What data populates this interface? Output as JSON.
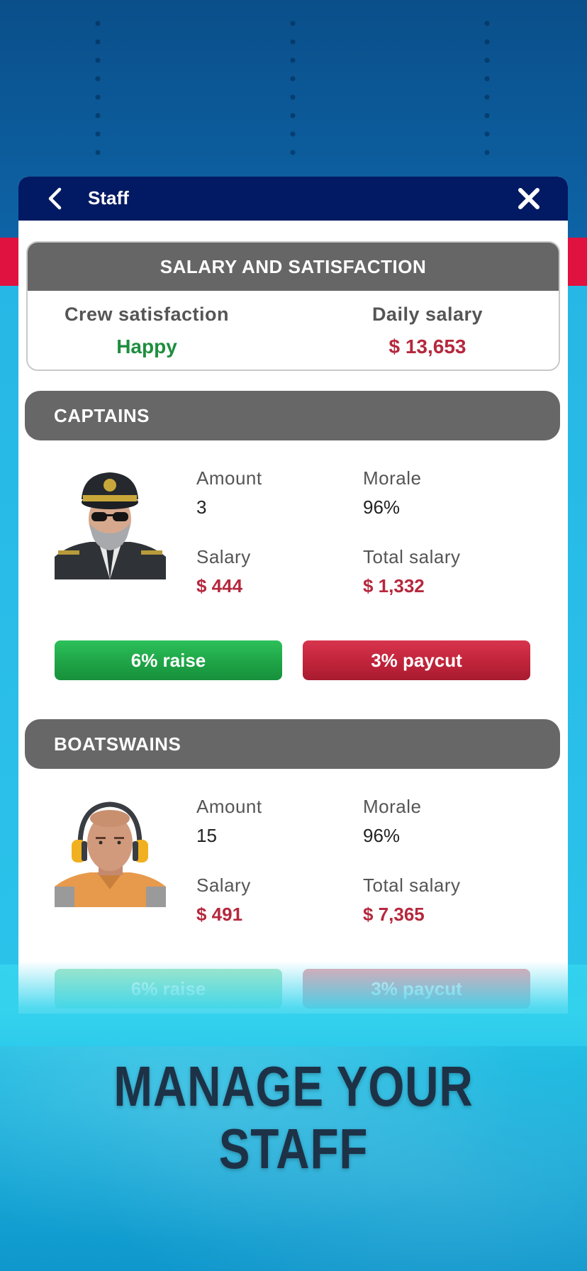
{
  "window": {
    "title": "Staff"
  },
  "icons": {
    "back": "chevron-left-icon",
    "close": "close-icon"
  },
  "summary": {
    "header": "SALARY AND SATISFACTION",
    "satisfaction_label": "Crew satisfaction",
    "satisfaction_value": "Happy",
    "daily_salary_label": "Daily salary",
    "daily_salary_value": "$ 13,653"
  },
  "sections": [
    {
      "header": "CAPTAINS",
      "amount_label": "Amount",
      "amount_value": "3",
      "morale_label": "Morale",
      "morale_value": "96%",
      "salary_label": "Salary",
      "salary_value": "$ 444",
      "total_salary_label": "Total salary",
      "total_salary_value": "$ 1,332",
      "raise_label": "6% raise",
      "paycut_label": "3% paycut"
    },
    {
      "header": "BOATSWAINS",
      "amount_label": "Amount",
      "amount_value": "15",
      "morale_label": "Morale",
      "morale_value": "96%",
      "salary_label": "Salary",
      "salary_value": "$ 491",
      "total_salary_label": "Total salary",
      "total_salary_value": "$ 7,365",
      "raise_label": "6% raise",
      "paycut_label": "3% paycut"
    }
  ],
  "promo": {
    "line1": "MANAGE YOUR",
    "line2": "STAFF"
  },
  "colors": {
    "titlebar": "#021a63",
    "section_header": "#676767",
    "positive": "#1e8e3e",
    "money": "#b5283d",
    "raise_button": "#1fa447",
    "paycut_button": "#c0243a"
  }
}
